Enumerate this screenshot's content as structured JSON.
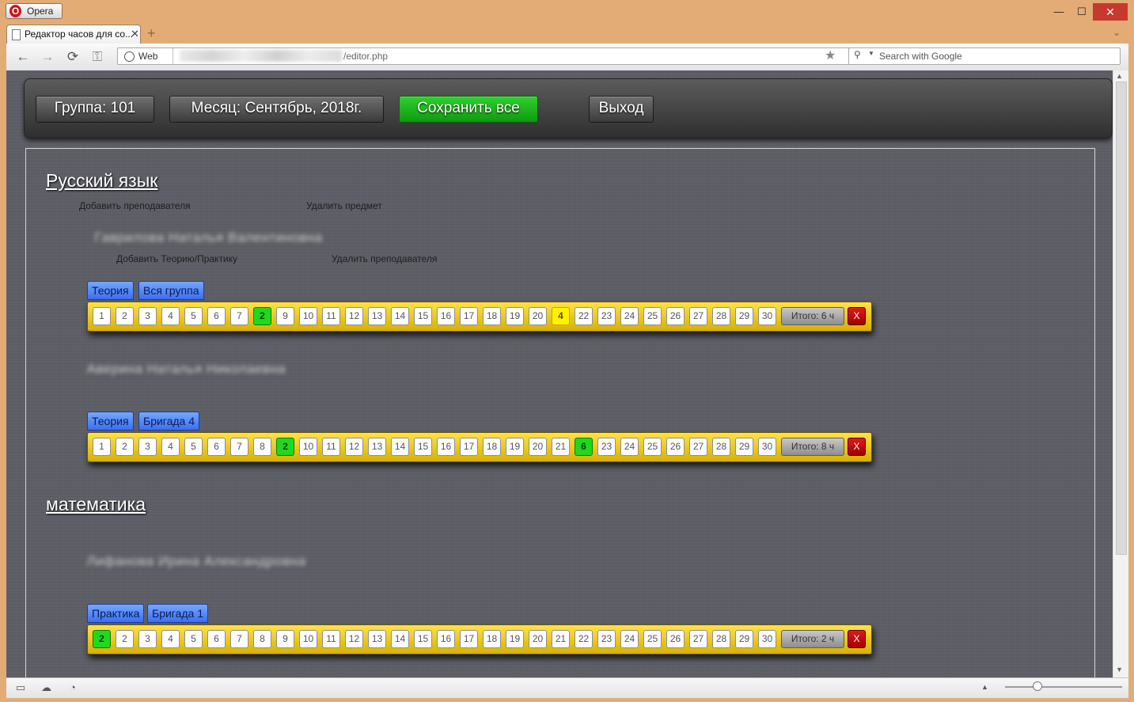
{
  "window": {
    "app_name": "Opera",
    "minimize_icon": "—",
    "maximize_icon": "☐",
    "close_icon": "✕"
  },
  "tab": {
    "title": "Редактор часов для со...",
    "close": "✕",
    "new_tab": "+",
    "menu": "⌄"
  },
  "nav": {
    "back": "←",
    "forward": "→",
    "reload": "⟳",
    "key": "⚿",
    "web_label": "Web",
    "url_suffix": "/editor.php",
    "bookmark": "★",
    "search_placeholder": "Search with Google",
    "search_glyph": "⚲",
    "search_caret": "▼"
  },
  "header": {
    "group_label": "Группа: 101",
    "month_label": "Месяц: Сентябрь, 2018г.",
    "save_label": "Сохранить все",
    "exit_label": "Выход"
  },
  "subjects": [
    {
      "name": "Русский язык",
      "add_teacher": "Добавить преподавателя",
      "delete_subject": "Удалить предмет"
    },
    {
      "name": "математика"
    }
  ],
  "teachers": [
    {
      "name": "Гаврилова Наталья Валентиновна",
      "add_theory": "Добавить Теорию/Практику",
      "delete_teacher": "Удалить преподавателя"
    },
    {
      "name": "Аверина Наталья Николаевна"
    },
    {
      "name": "Лифанова Ирина Александровна"
    }
  ],
  "rows": [
    {
      "type": "Теория",
      "group": "Вся группа",
      "total": "Итого: 6 ч",
      "delete": "X",
      "days": [
        "1",
        "2",
        "3",
        "4",
        "5",
        "6",
        "7",
        "2",
        "9",
        "10",
        "11",
        "12",
        "13",
        "14",
        "15",
        "16",
        "17",
        "18",
        "19",
        "20",
        "4",
        "22",
        "23",
        "24",
        "25",
        "26",
        "27",
        "28",
        "29",
        "30"
      ],
      "highlight": {
        "7": "green",
        "20": "yellow"
      }
    },
    {
      "type": "Теория",
      "group": "Бригада 4",
      "total": "Итого: 8 ч",
      "delete": "X",
      "days": [
        "1",
        "2",
        "3",
        "4",
        "5",
        "6",
        "7",
        "8",
        "2",
        "10",
        "11",
        "12",
        "13",
        "14",
        "15",
        "16",
        "17",
        "18",
        "19",
        "20",
        "21",
        "6",
        "23",
        "24",
        "25",
        "26",
        "27",
        "28",
        "29",
        "30"
      ],
      "highlight": {
        "8": "green",
        "21": "green"
      }
    },
    {
      "type": "Практика",
      "group": "Бригада 1",
      "total": "Итого: 2 ч",
      "delete": "X",
      "days": [
        "2",
        "2",
        "3",
        "4",
        "5",
        "6",
        "7",
        "8",
        "9",
        "10",
        "11",
        "12",
        "13",
        "14",
        "15",
        "16",
        "17",
        "18",
        "19",
        "20",
        "21",
        "22",
        "23",
        "24",
        "25",
        "26",
        "27",
        "28",
        "29",
        "30"
      ],
      "highlight": {
        "0": "green"
      }
    }
  ],
  "colors": {
    "accent_green": "#1fd91f",
    "accent_yellow": "#fff200",
    "bar_yellow": "#ffe24a",
    "delete_red": "#c00000",
    "tag_blue": "#3b6ff0"
  },
  "statusbar": {
    "panel_icon": "▭",
    "cloud_icon": "☁",
    "speed_icon": "◔",
    "up_icon": "▲"
  },
  "scroll": {
    "up": "▲",
    "down": "▼"
  }
}
